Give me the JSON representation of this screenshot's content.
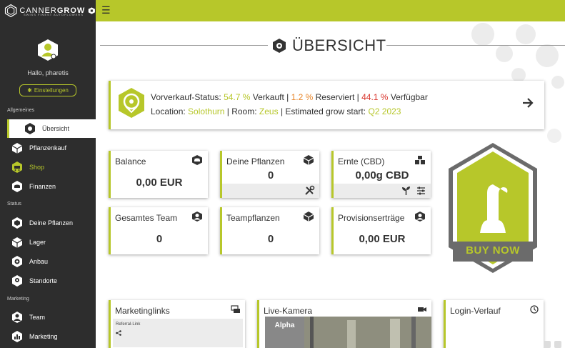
{
  "app": {
    "logo_text_1": "CANNER",
    "logo_text_2": "GROW",
    "logo_subtitle": "SWISS FINEST AUTOFLOWERS",
    "accent": "#b7c72a",
    "sidebar_bg": "#2d2d2d"
  },
  "topbar": {
    "menu_icon": "☰"
  },
  "sidebar": {
    "greeting": "Hallo, pharetis",
    "settings_label": "Einstellungen",
    "section_general": "Allgemeines",
    "section_status": "Status",
    "section_marketing": "Marketing",
    "items": [
      {
        "label": "Übersicht",
        "icon": "overview-icon"
      },
      {
        "label": "Pflanzenkauf",
        "icon": "cube-icon"
      },
      {
        "label": "Shop",
        "icon": "cart-icon"
      },
      {
        "label": "Finanzen",
        "icon": "coins-icon"
      },
      {
        "label": "Deine Pflanzen",
        "icon": "plant-icon"
      },
      {
        "label": "Lager",
        "icon": "box-icon"
      },
      {
        "label": "Anbau",
        "icon": "grow-icon"
      },
      {
        "label": "Standorte",
        "icon": "location-icon"
      },
      {
        "label": "Team",
        "icon": "team-icon"
      },
      {
        "label": "Marketing",
        "icon": "marketing-icon"
      }
    ]
  },
  "main": {
    "title": "ÜBERSICHT",
    "status": {
      "presale_label": "Vorverkauf-Status:",
      "sold_pct": "54.7 %",
      "sold_label": "Verkauft |",
      "reserved_pct": "1.2 %",
      "reserved_label": "Reserviert |",
      "available_pct": "44.1 %",
      "available_label": "Verfügbar",
      "location_label": "Location:",
      "location": "Solothurn",
      "room_label": "| Room:",
      "room": "Zeus",
      "grow_label": "| Estimated grow start:",
      "grow_start": "Q2 2023"
    },
    "stats": [
      {
        "label": "Balance",
        "value": "0,00 EUR"
      },
      {
        "label": "Deine Pflanzen",
        "value": "0"
      },
      {
        "label": "Ernte (CBD)",
        "value": "0,00g CBD"
      },
      {
        "label": "Gesamtes Team",
        "value": "0"
      },
      {
        "label": "Teampflanzen",
        "value": "0"
      },
      {
        "label": "Provisionserträge",
        "value": "0,00 EUR"
      }
    ],
    "buy_now": "BUY NOW",
    "marketing_links": {
      "label": "Marketinglinks",
      "referral_label": "Referral-Link"
    },
    "live_camera": {
      "label": "Live-Kamera",
      "alpha_label": "Alpha"
    },
    "login_history": {
      "label": "Login-Verlauf"
    }
  }
}
